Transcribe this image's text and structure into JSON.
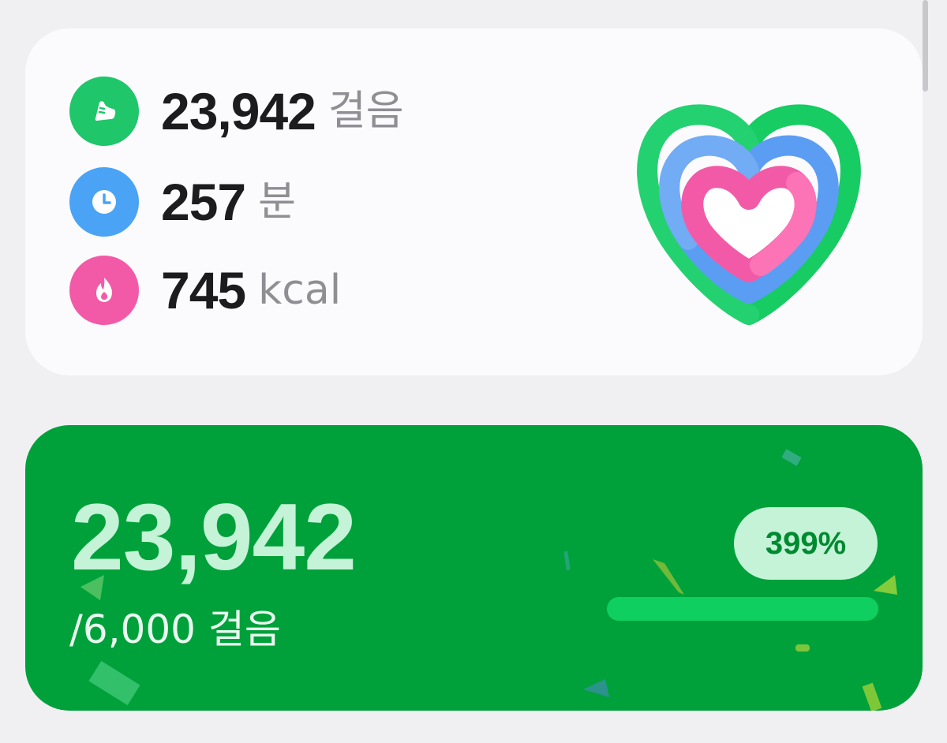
{
  "summary": {
    "steps": {
      "value": "23,942",
      "unit": "걸음",
      "icon": "shoe-icon",
      "color": "#1fc66a"
    },
    "minutes": {
      "value": "257",
      "unit": "분",
      "icon": "clock-icon",
      "color": "#4aa3f5"
    },
    "calories": {
      "value": "745",
      "unit": "kcal",
      "icon": "flame-icon",
      "color": "#f25aa8"
    }
  },
  "activity_rings": {
    "icon": "activity-heart-icon",
    "colors": {
      "outer": "#16cc63",
      "middle": "#5b9df2",
      "inner": "#f25aa8"
    }
  },
  "steps_card": {
    "count": "23,942",
    "goal_text": "/6,000 걸음",
    "percent_label": "399%",
    "progress": 1.0,
    "background": "#00a13a"
  }
}
